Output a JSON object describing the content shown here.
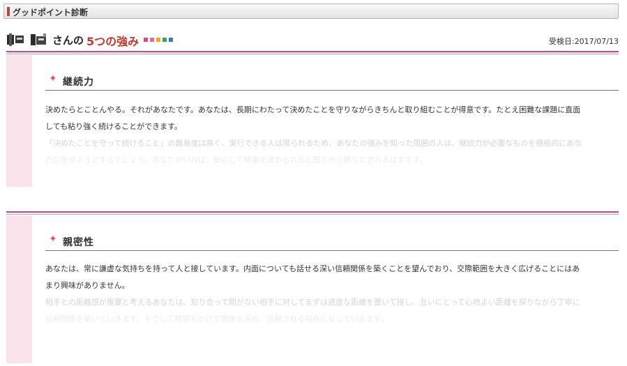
{
  "tab": {
    "title": "グッドポイント診断"
  },
  "header": {
    "suffix": "さんの",
    "title": "5つの強み",
    "squares": [
      "#e0457f",
      "#e76a93",
      "#f0a33a",
      "#3fa34d",
      "#2f7dc4"
    ],
    "date": "受検日:2017/07/13"
  },
  "sections": [
    {
      "title": "継続力",
      "lines": [
        "決めたらとことんやる。それがあなたです。あなたは、長期にわたって決めたことを守りながらきちんと取り組むことが得意です。たとえ困難な課題に直面",
        "しても粘り強く続けることができます。",
        "「決めたことを守って続けること」の難易度は高く、実行できる人は限られるため、あなたの強みを知った周囲の人は、継続力が必要なものを積極的にあな",
        "たに任せようとするでしょう。あなたがいれば、安心して物事を進められると周りから頼りにされるはずです。"
      ]
    },
    {
      "title": "親密性",
      "lines": [
        "あなたは、常に謙虚な気持ちを持って人と接しています。内面についても話せる深い信頼関係を築くことを望んでおり、交際範囲を大きく広げることにはあ",
        "まり興味がありません。",
        "相手との距離感が重要と考えるあなたは、知り合って間がない相手に対してまずは適度な距離を置いて接し、互いにとって心地よい距離を探りながら丁寧に",
        "信頼関係を築いていきます。そうして時間をかけて関係を深め、信頼される存在になっていきます。"
      ]
    }
  ]
}
